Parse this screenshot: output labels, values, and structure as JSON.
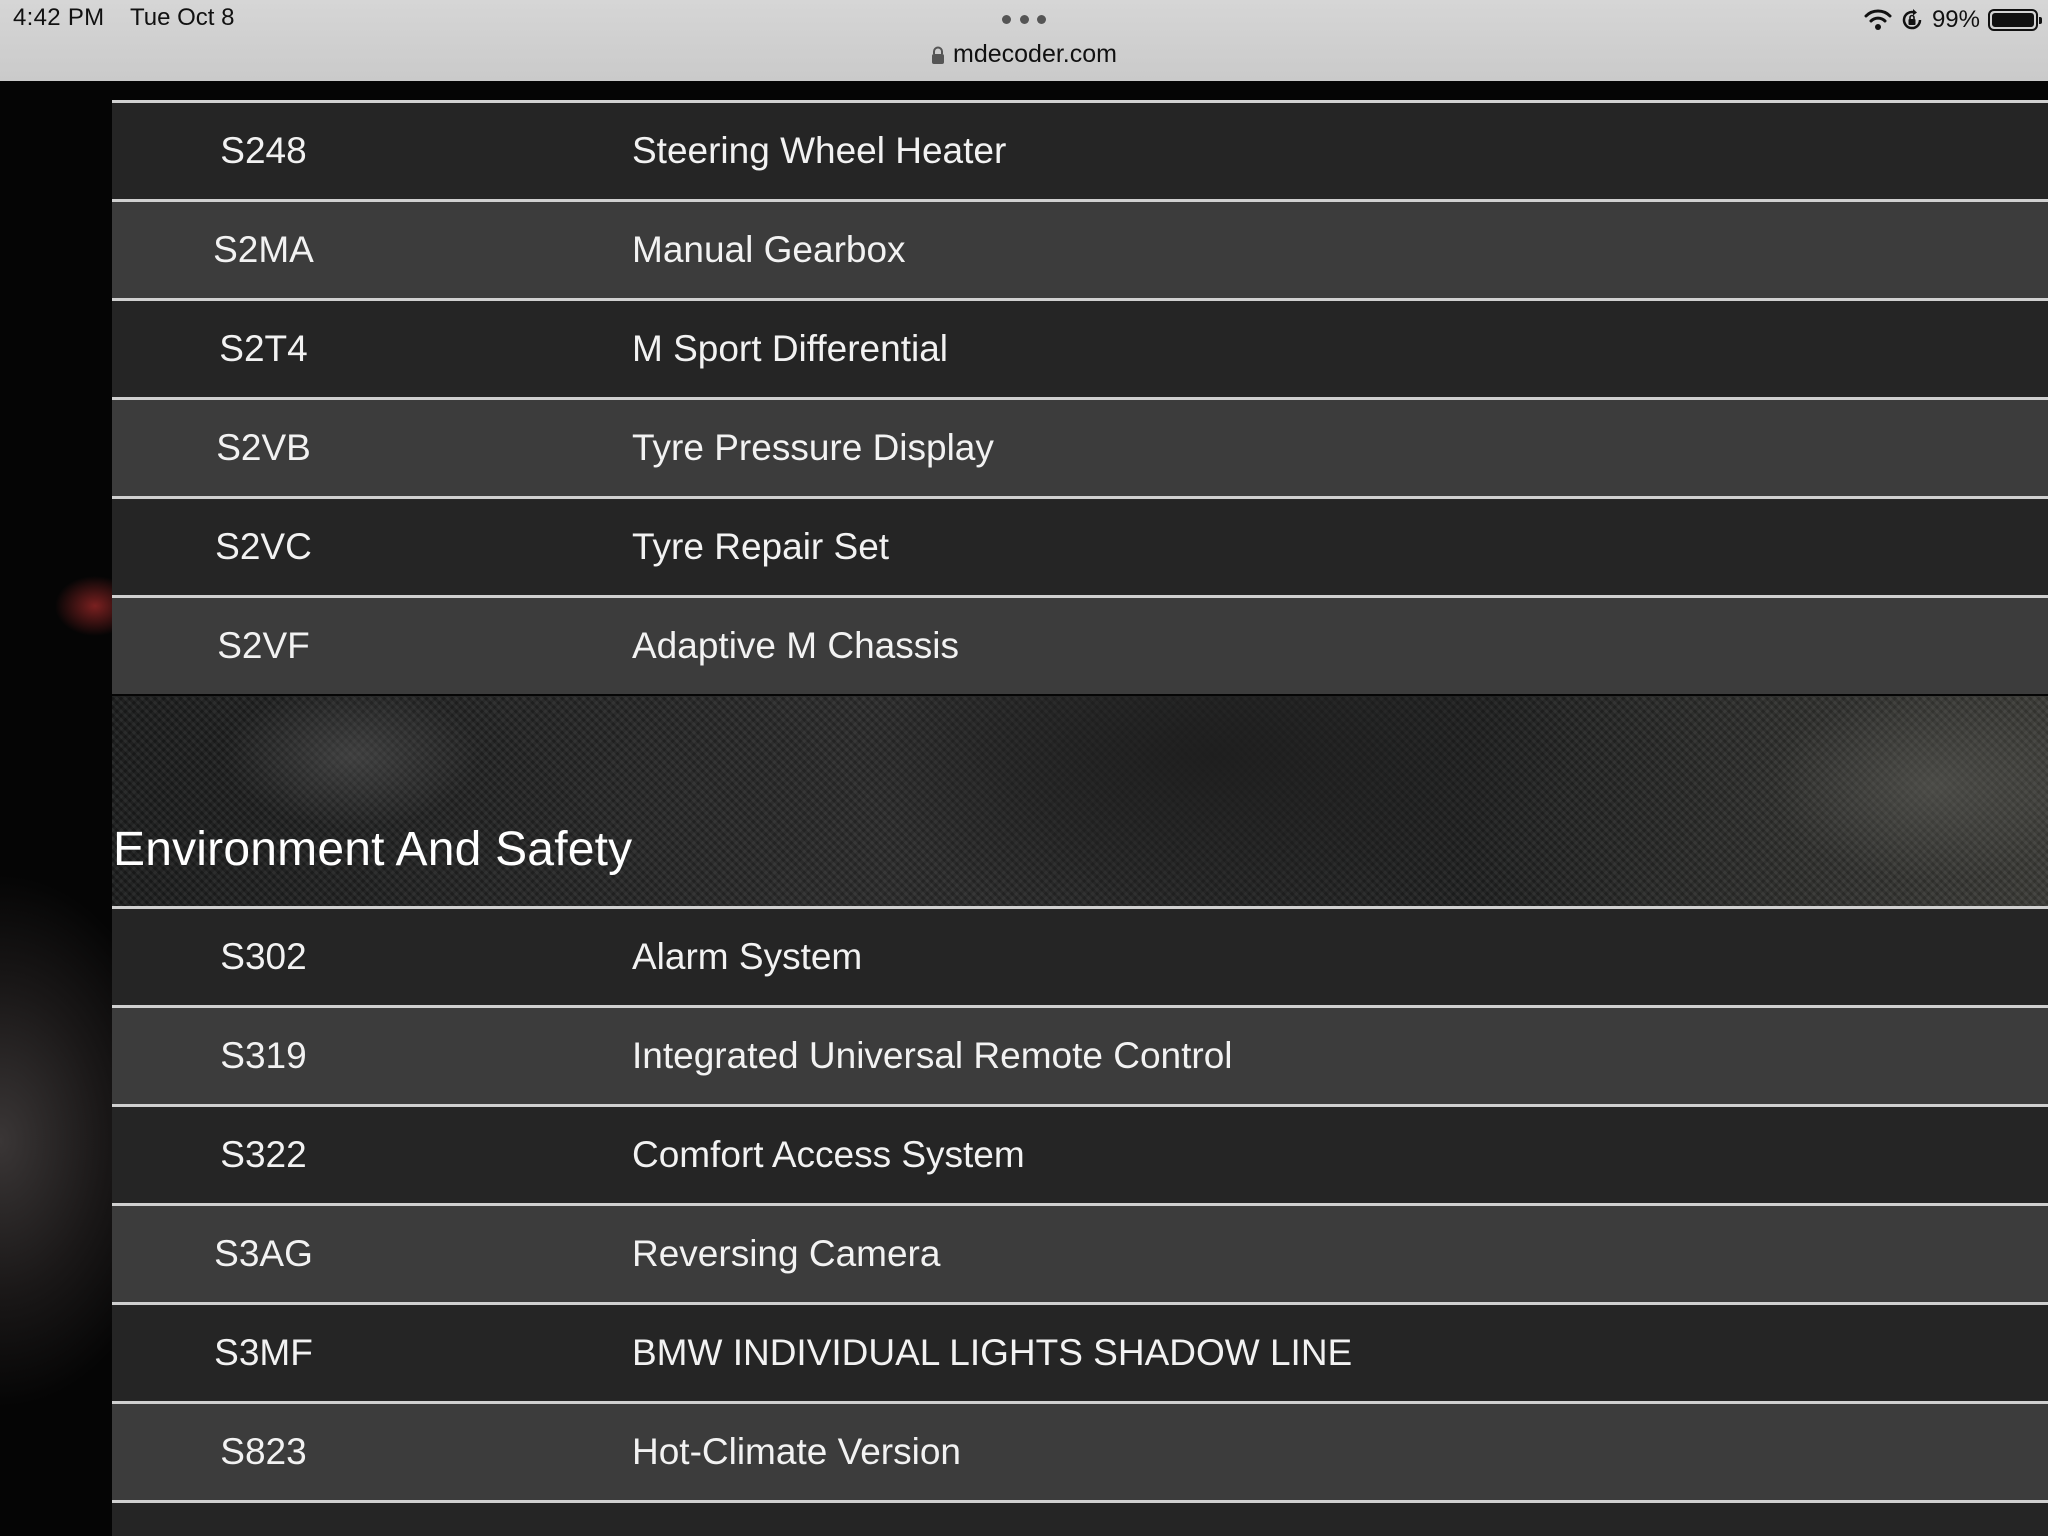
{
  "status_bar": {
    "time": "4:42 PM",
    "date": "Tue Oct 8",
    "battery_percent": "99%",
    "battery_level": 0.99
  },
  "address_bar": {
    "url": "mdecoder.com"
  },
  "table_top": {
    "rows": [
      {
        "code": "S248",
        "description": "Steering Wheel Heater"
      },
      {
        "code": "S2MA",
        "description": "Manual Gearbox"
      },
      {
        "code": "S2T4",
        "description": "M Sport Differential"
      },
      {
        "code": "S2VB",
        "description": "Tyre Pressure Display"
      },
      {
        "code": "S2VC",
        "description": "Tyre Repair Set"
      },
      {
        "code": "S2VF",
        "description": "Adaptive M Chassis"
      }
    ]
  },
  "section": {
    "title": "Environment And Safety"
  },
  "table_safety": {
    "rows": [
      {
        "code": "S302",
        "description": "Alarm System"
      },
      {
        "code": "S319",
        "description": "Integrated Universal Remote Control"
      },
      {
        "code": "S322",
        "description": "Comfort Access System"
      },
      {
        "code": "S3AG",
        "description": "Reversing Camera"
      },
      {
        "code": "S3MF",
        "description": "BMW INDIVIDUAL LIGHTS SHADOW LINE"
      },
      {
        "code": "S823",
        "description": "Hot-Climate Version"
      }
    ]
  }
}
